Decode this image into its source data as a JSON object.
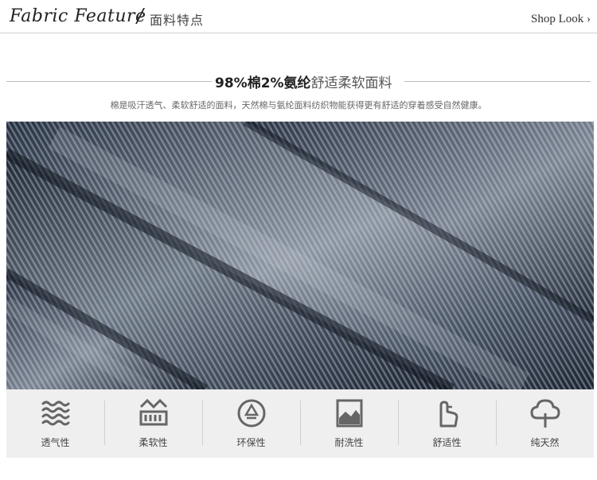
{
  "header": {
    "brand_en": "Fabric Feature",
    "brand_separator": "/",
    "brand_cn": "面料特点",
    "shop_look": "Shop Look ›"
  },
  "title": {
    "strong": "98%棉2%氨纶",
    "light": "舒适柔软面料"
  },
  "subtitle": "棉是吸汗透气、柔软舒适的面料，天然棉与氨纶面料纺织物能获得更有舒适的穿着感受自然健康。",
  "features": [
    {
      "label": "透气性",
      "icon": "wave-icon"
    },
    {
      "label": "柔软性",
      "icon": "soft-icon"
    },
    {
      "label": "环保性",
      "icon": "recycle-icon"
    },
    {
      "label": "耐洗性",
      "icon": "wash-icon"
    },
    {
      "label": "舒适性",
      "icon": "hand-icon"
    },
    {
      "label": "纯天然",
      "icon": "tree-icon"
    }
  ],
  "colors": {
    "icon_gray": "#666666",
    "bar_bg": "#efefef",
    "denim_dark": "#2e3a4a",
    "denim_light": "#8a93a0"
  }
}
